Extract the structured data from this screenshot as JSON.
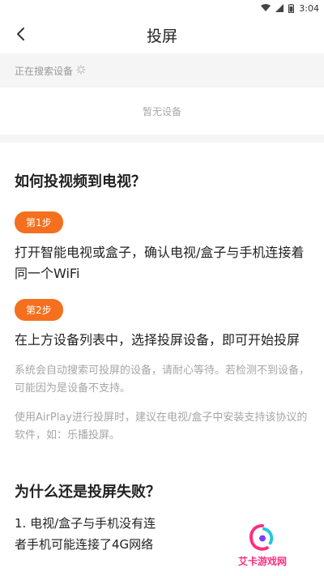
{
  "status_bar": {
    "time": "3:04"
  },
  "header": {
    "title": "投屏"
  },
  "search": {
    "status": "正在搜索设备"
  },
  "devices": {
    "empty_text": "暂无设备"
  },
  "guide": {
    "heading": "如何投视频到电视？",
    "steps": [
      {
        "badge": "第1步",
        "text": "打开智能电视或盒子，确认电视/盒子与手机连接着同一个WiFi"
      },
      {
        "badge": "第2步",
        "text": "在上方设备列表中，选择投屏设备，即可开始投屏"
      }
    ],
    "notes": [
      "系统会自动搜索可投屏的设备，请耐心等待。若检测不到设备，可能因为是设备不支持。",
      "使用AirPlay进行投屏时，建议在电视/盒子中安装支持该协议的软件，如：乐播投屏。"
    ]
  },
  "faq": {
    "heading": "为什么还是投屏失败？",
    "items": [
      "1. 电视/盒子与手机没有连",
      "者手机可能连接了4G网络"
    ]
  },
  "watermark": {
    "text": "艾卡游戏网"
  },
  "colors": {
    "accent": "#f4701e",
    "watermark": "#ff2e7e"
  }
}
